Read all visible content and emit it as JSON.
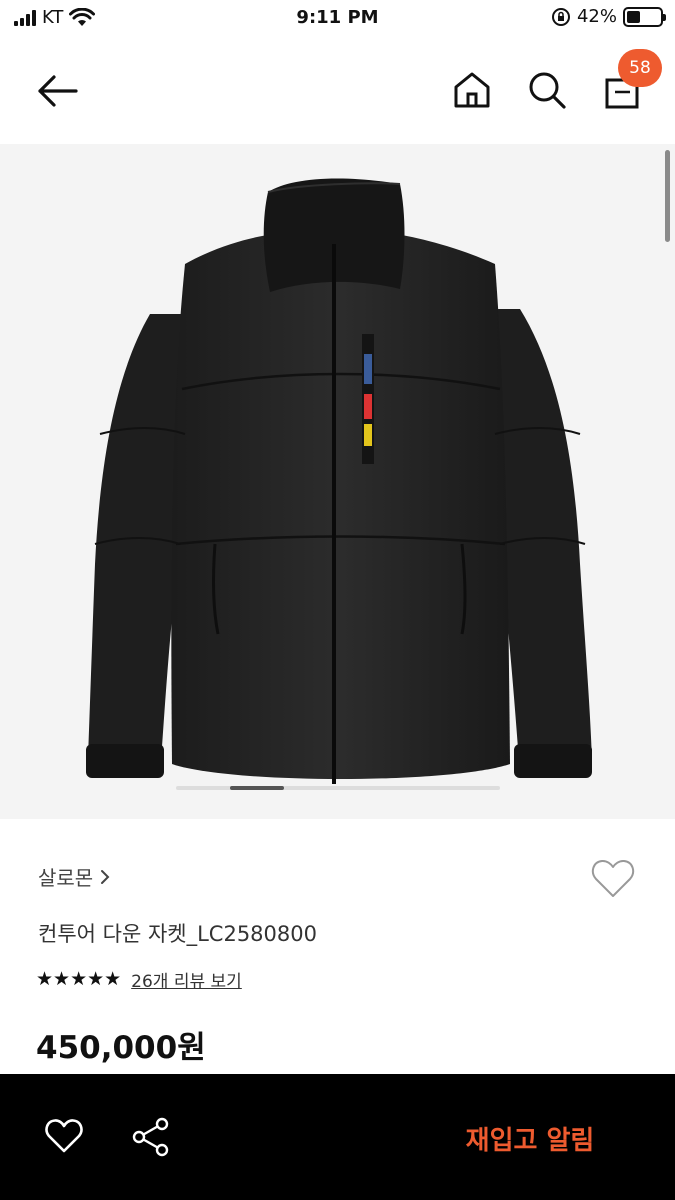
{
  "status_bar": {
    "carrier": "KT",
    "time": "9:11 PM",
    "battery_percent_label": "42%",
    "battery_level": 0.42
  },
  "nav": {
    "bag_count": "58",
    "icons": [
      "back-arrow-icon",
      "home-icon",
      "search-icon",
      "shopping-bag-icon"
    ]
  },
  "product_image": {
    "carousel_total": 6,
    "carousel_active_index": 1
  },
  "product": {
    "brand": "살로몬",
    "name": "컨투어 다운 자켓_LC2580800",
    "stars": "★★★★★",
    "rating": 5,
    "review_link": "26개 리뷰 보기",
    "price": "450,000원"
  },
  "bottom_bar": {
    "restock_label": "재입고 알림"
  },
  "colors": {
    "accent": "#ee5b2f",
    "bottom_bar_bg": "#000000"
  }
}
